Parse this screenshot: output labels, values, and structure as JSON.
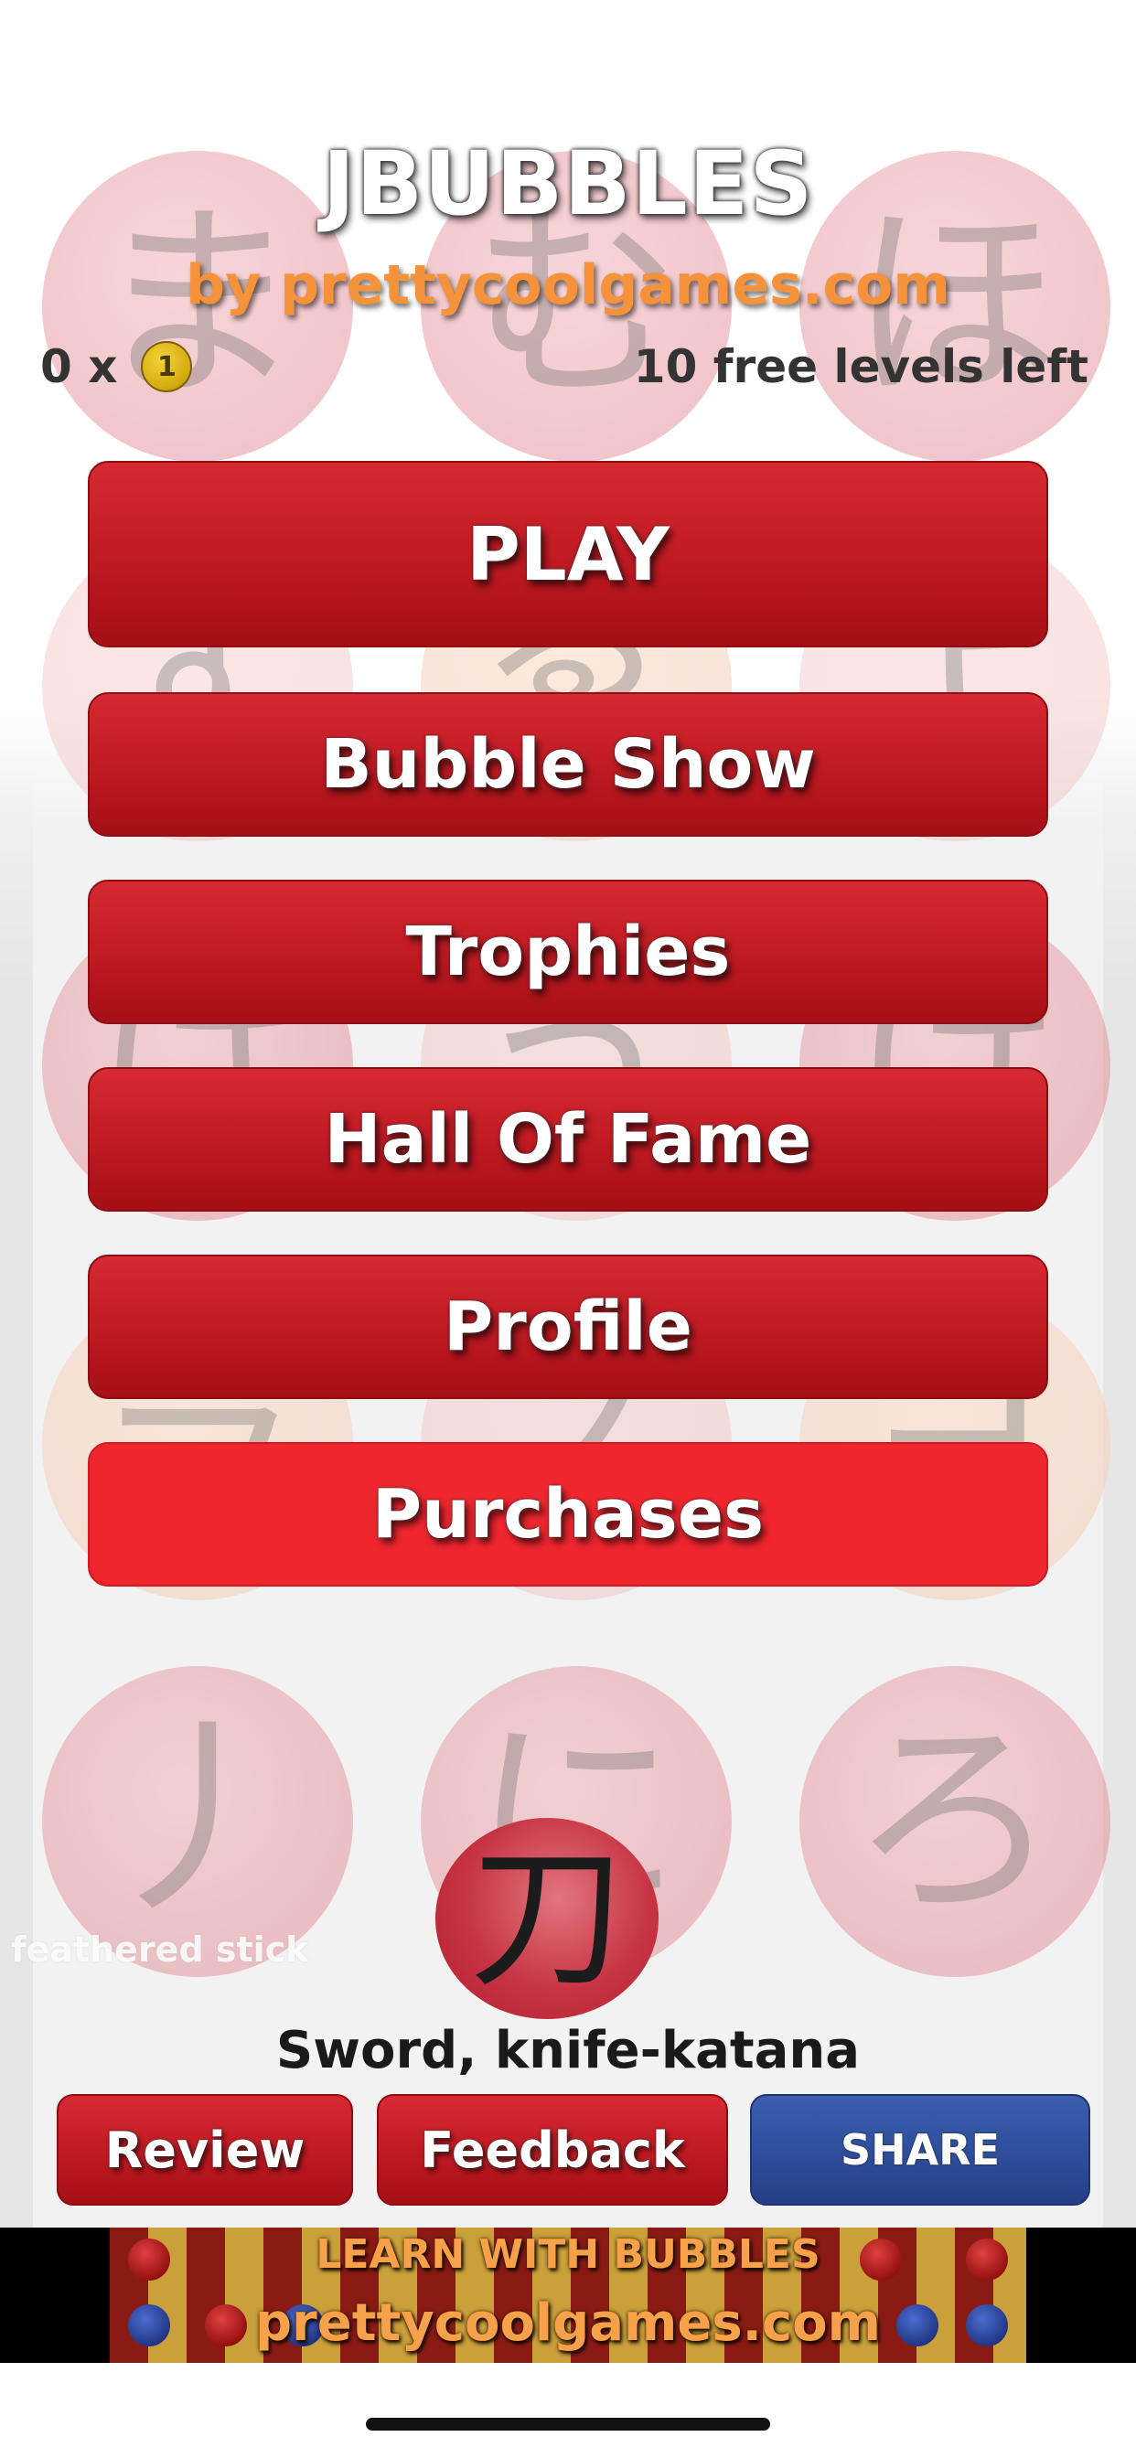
{
  "header": {
    "title": "JBUBBLES",
    "subtitle": "by prettycoolgames.com",
    "coins": "0 x",
    "coin_icon_label": "1",
    "levels_left": "10 free levels left"
  },
  "background_bubbles": [
    "ま",
    "む",
    "ほ",
    "す",
    "ゑ",
    "よ",
    "は",
    "う",
    "け",
    "ラ",
    "ス",
    "ヨ",
    "丿",
    "に",
    "ろ"
  ],
  "menu": {
    "play": "PLAY",
    "bubble_show": "Bubble Show",
    "trophies": "Trophies",
    "hall_of_fame": "Hall Of Fame",
    "profile": "Profile",
    "purchases": "Purchases"
  },
  "word": {
    "kanji": "刀",
    "meaning": "Sword, knife-katana",
    "caption_faint": "feathered stick"
  },
  "actions": {
    "review": "Review",
    "feedback": "Feedback",
    "share": "SHARE"
  },
  "ad": {
    "line1": "LEARN WITH BUBBLES",
    "line2": "prettycoolgames.com"
  },
  "colors": {
    "button_red": "#c41c24",
    "button_highlight": "#f0262f",
    "share_blue": "#2f4f9c",
    "subtitle_orange": "#f6923a"
  }
}
